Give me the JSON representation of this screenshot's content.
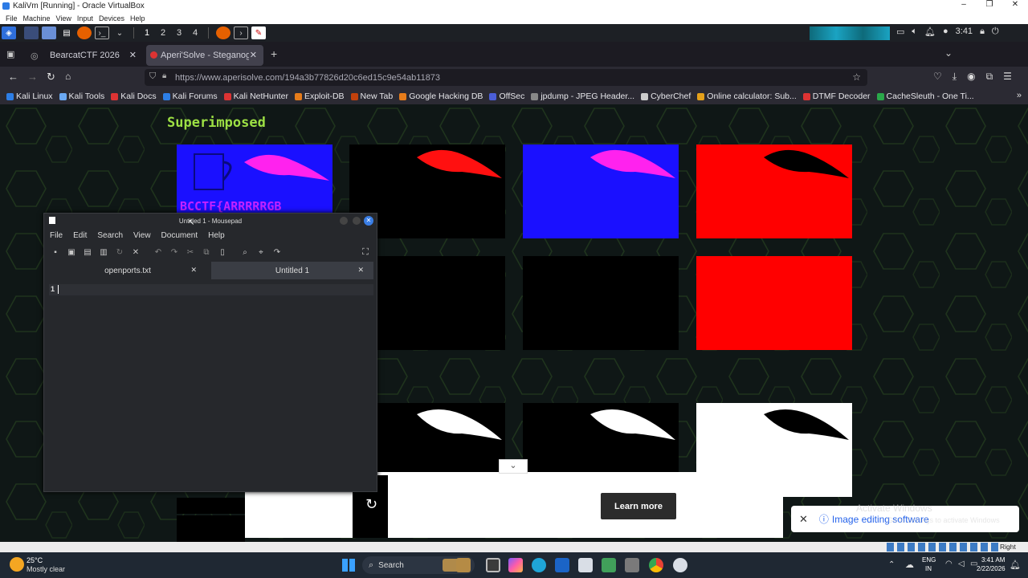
{
  "vbox": {
    "title": "KaliVm [Running] - Oracle VirtualBox",
    "menu": [
      "File",
      "Machine",
      "View",
      "Input",
      "Devices",
      "Help"
    ],
    "controls": [
      "–",
      "❐",
      "✕"
    ]
  },
  "kali": {
    "workspaces": [
      "1",
      "2",
      "3",
      "4"
    ],
    "clock": "3:41"
  },
  "browser": {
    "tabs": [
      {
        "label": "BearcatCTF 2026"
      },
      {
        "label": "Aperi'Solve - Steganogra"
      }
    ],
    "url": "https://www.aperisolve.com/194a3b77826d20c6ed15c9e54ab11873",
    "bookmarks": [
      "Kali Linux",
      "Kali Tools",
      "Kali Docs",
      "Kali Forums",
      "Kali NetHunter",
      "Exploit-DB",
      "New Tab",
      "Google Hacking DB",
      "OffSec",
      "jpdump - JPEG Header...",
      "CyberChef",
      "Online calculator: Sub...",
      "DTMF Decoder",
      "CacheSleuth - One Ti..."
    ],
    "bookmark_colors": [
      "#2d7ee6",
      "#6aa8f2",
      "#d33",
      "#2d7ee6",
      "#d33",
      "#e77c1a",
      "#c2410c",
      "#e77c1a",
      "#4b5ed8",
      "#888",
      "#ccc",
      "#e5a11a",
      "#d33",
      "#2aa84a"
    ]
  },
  "page": {
    "section_title": "Superimposed",
    "flag_text": "BCCTF{ARRRRRGB",
    "learn_more": "Learn more"
  },
  "mousepad": {
    "title": "Untitled 1 - Mousepad",
    "menu": [
      "File",
      "Edit",
      "Search",
      "View",
      "Document",
      "Help"
    ],
    "tabs": [
      {
        "label": "openports.txt"
      },
      {
        "label": "Untitled 1"
      }
    ],
    "line_number": "1"
  },
  "toast": {
    "text": "Image editing software"
  },
  "watermark": {
    "line1": "Activate Windows",
    "line2": "Go to Settings to activate Windows."
  },
  "statusbar": {
    "host_key": "Right Ctrl"
  },
  "taskbar": {
    "weather_temp": "25°C",
    "weather_desc": "Mostly clear",
    "search": "Search",
    "lang1": "ENG",
    "lang2": "IN",
    "time": "3:41 AM",
    "date": "2/22/2026"
  }
}
